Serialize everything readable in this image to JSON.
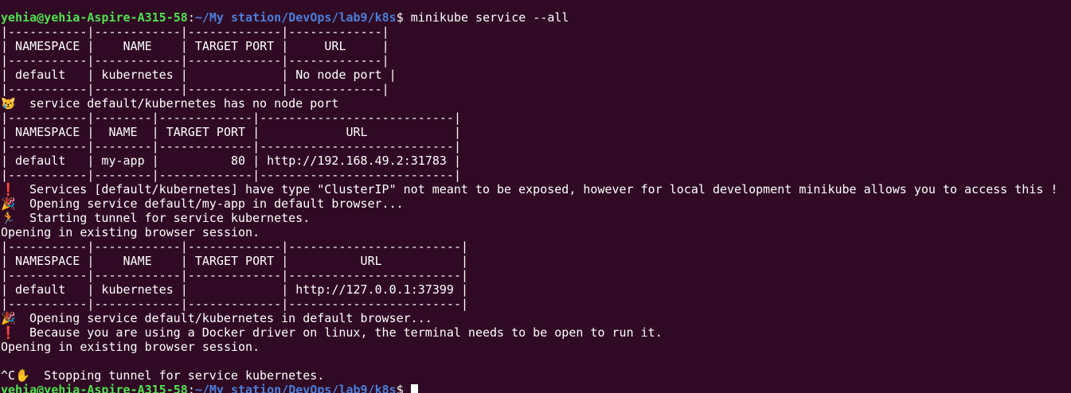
{
  "terminal": {
    "prompt": {
      "user_host": "yehia@yehia-Aspire-A315-58",
      "path": "~/My station/DevOps/lab9/k8s",
      "symbol": "$"
    },
    "command": " minikube service --all",
    "icons": {
      "crying_cat": "😿",
      "exclamation": "❗",
      "party": "🎉",
      "runner": "🏃",
      "hand": "✋"
    },
    "tables": [
      {
        "border": "|-----------|------------|-------------|-------------|",
        "header": "| NAMESPACE |    NAME    | TARGET PORT |     URL     |",
        "row": "| default   | kubernetes |             | No node port |"
      },
      {
        "border": "|-----------|--------|-------------|---------------------------|",
        "header": "| NAMESPACE |  NAME  | TARGET PORT |            URL            |",
        "row": "| default   | my-app |          80 | http://192.168.49.2:31783 |"
      },
      {
        "border": "|-----------|------------|-------------|------------------------|",
        "header": "| NAMESPACE |    NAME    | TARGET PORT |          URL           |",
        "row": "| default   | kubernetes |             | http://127.0.0.1:37399 |"
      }
    ],
    "messages": {
      "no_node_port": " service default/kubernetes has no node port",
      "cluster_ip_warning": " Services [default/kubernetes] have type \"ClusterIP\" not meant to be exposed, however for local development minikube allows you to access this !",
      "opening_my_app": " Opening service default/my-app in default browser...",
      "starting_tunnel": " Starting tunnel for service kubernetes.",
      "existing_session_1": "Opening in existing browser session.",
      "opening_kubernetes": " Opening service default/kubernetes in default browser...",
      "docker_driver_note": " Because you are using a Docker driver on linux, the terminal needs to be open to run it.",
      "existing_session_2": "Opening in existing browser session.",
      "ctrl_c": "^C",
      "stopping_tunnel": " Stopping tunnel for service kubernetes."
    }
  }
}
